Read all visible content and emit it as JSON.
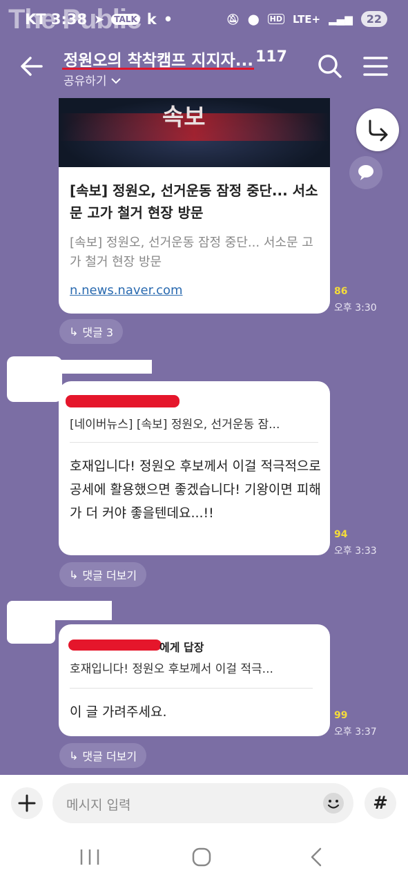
{
  "status": {
    "carrier_time": "KT 3:38",
    "watermark": "The Public",
    "network": "LTE+",
    "battery": "22"
  },
  "header": {
    "title": "정원오의 착착캠프 지지자...",
    "member_count": "117",
    "share_label": "공유하기"
  },
  "messages": [
    {
      "thumb_text": "속보",
      "card_title": "[속보] 정원오, 선거운동 잠정 중단... 서소문 고가 철거 현장 방문",
      "card_desc": "[속보] 정원오, 선거운동 잠정 중단... 서소문 고가 철거 현장 방문",
      "link": "n.news.naver.com",
      "reads": "86",
      "time": "오후 3:30",
      "reply_chip": "댓글 3"
    },
    {
      "quote": "[네이버뉴스] [속보] 정원오, 선거운동 잠...",
      "text": "호재입니다! 정원오 후보께서 이걸 적극적으로 공세에 활용했으면 좋겠습니다! 기왕이면 피해가 더 커야 좋을텐데요...!!",
      "reads": "94",
      "time": "오후 3:33",
      "reply_chip": "댓글 더보기"
    },
    {
      "reply_to_suffix": "에게 답장",
      "quote": "호재입니다! 정원오 후보께서 이걸 적극...",
      "text": "이 글 가려주세요.",
      "reads": "99",
      "time": "오후 3:37",
      "reply_chip": "댓글 더보기"
    }
  ],
  "input": {
    "placeholder": "메시지 입력",
    "hash_label": "#"
  },
  "colors": {
    "background": "#7b6ea4",
    "reads_yellow": "#f5dc3a",
    "redaction_red": "#e5162b"
  }
}
